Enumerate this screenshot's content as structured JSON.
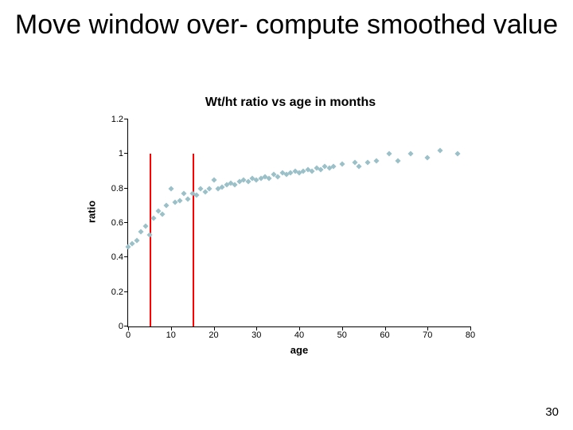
{
  "slide": {
    "title": "Move window over- compute smoothed value",
    "page_number": "30"
  },
  "chart_data": {
    "type": "scatter",
    "title": "Wt/ht ratio vs age in months",
    "xlabel": "age",
    "ylabel": "ratio",
    "xlim": [
      0,
      80
    ],
    "ylim": [
      0,
      1.2
    ],
    "xticks": [
      0,
      10,
      20,
      30,
      40,
      50,
      60,
      70,
      80
    ],
    "yticks": [
      0,
      0.2,
      0.4,
      0.6,
      0.8,
      1,
      1.2
    ],
    "window_lines_x": [
      5,
      15
    ],
    "window_line_y_extent": 1.0,
    "x": [
      0,
      1,
      2,
      3,
      4,
      5,
      6,
      7,
      8,
      9,
      10,
      11,
      12,
      13,
      14,
      15,
      16,
      17,
      18,
      19,
      20,
      21,
      22,
      23,
      24,
      25,
      26,
      27,
      28,
      29,
      30,
      31,
      32,
      33,
      34,
      35,
      36,
      37,
      38,
      39,
      40,
      41,
      42,
      43,
      44,
      45,
      46,
      47,
      48,
      50,
      53,
      54,
      56,
      58,
      61,
      63,
      66,
      70,
      73,
      77
    ],
    "y": [
      0.46,
      0.48,
      0.5,
      0.55,
      0.58,
      0.53,
      0.63,
      0.67,
      0.65,
      0.7,
      0.8,
      0.72,
      0.73,
      0.77,
      0.74,
      0.77,
      0.76,
      0.8,
      0.78,
      0.8,
      0.85,
      0.8,
      0.81,
      0.82,
      0.83,
      0.82,
      0.84,
      0.85,
      0.84,
      0.86,
      0.85,
      0.86,
      0.87,
      0.86,
      0.88,
      0.87,
      0.89,
      0.88,
      0.89,
      0.9,
      0.89,
      0.9,
      0.91,
      0.9,
      0.92,
      0.91,
      0.93,
      0.92,
      0.93,
      0.94,
      0.95,
      0.93,
      0.95,
      0.96,
      1.0,
      0.96,
      1.0,
      0.98,
      1.02,
      1.0
    ]
  }
}
